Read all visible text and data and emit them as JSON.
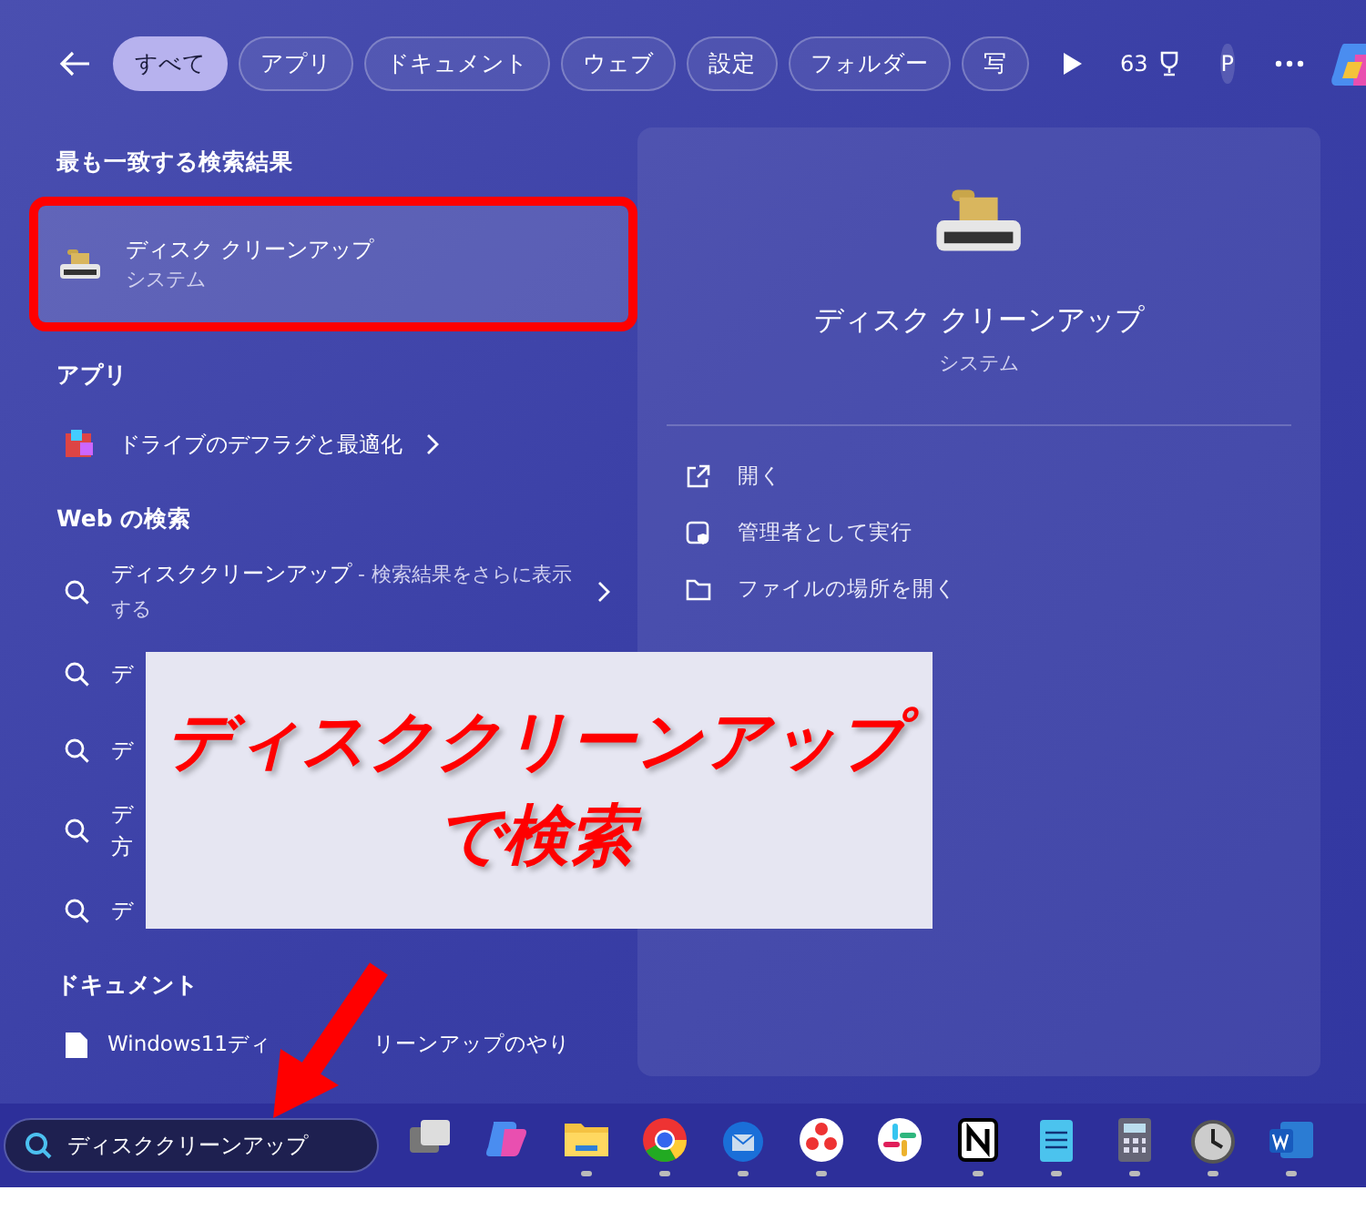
{
  "header": {
    "tabs": [
      {
        "label": "すべて",
        "selected": true
      },
      {
        "label": "アプリ",
        "selected": false
      },
      {
        "label": "ドキュメント",
        "selected": false
      },
      {
        "label": "ウェブ",
        "selected": false
      },
      {
        "label": "設定",
        "selected": false
      },
      {
        "label": "フォルダー",
        "selected": false
      },
      {
        "label": "写",
        "selected": false
      }
    ],
    "points": "63",
    "account": "P"
  },
  "best_match": {
    "heading": "最も一致する検索結果",
    "title": "ディスク クリーンアップ",
    "subtitle": "システム",
    "marked": true
  },
  "apps": {
    "heading": "アプリ",
    "items": [
      {
        "label": "ドライブのデフラグと最適化"
      }
    ]
  },
  "web": {
    "heading": "Web の検索",
    "items": [
      {
        "text": "ディスククリーンアップ",
        "suffix": "- 検索結果をさらに表示する",
        "chevron": true
      },
      {
        "text": "デ"
      },
      {
        "text": "デ"
      },
      {
        "text": "デ",
        "line2": "方"
      },
      {
        "text": "デ"
      }
    ]
  },
  "documents": {
    "heading": "ドキュメント",
    "items": [
      {
        "label": "Windows11ディ",
        "label_after_arrow": "リーンアップのやり"
      }
    ]
  },
  "preview": {
    "title": "ディスク クリーンアップ",
    "subtitle": "システム",
    "actions": [
      {
        "label": "開く",
        "kind": "open"
      },
      {
        "label": "管理者として実行",
        "kind": "admin"
      },
      {
        "label": "ファイルの場所を開く",
        "kind": "folder"
      }
    ]
  },
  "annotation": {
    "lines": [
      "ディスククリーンアップ",
      "で検索"
    ]
  },
  "taskbar": {
    "search_value": "ディスククリーンアップ",
    "apps": [
      {
        "kind": "windows",
        "running": false
      },
      {
        "kind": "copilot",
        "running": false
      },
      {
        "kind": "folder",
        "running": true
      },
      {
        "kind": "browser",
        "running": true
      },
      {
        "kind": "mail",
        "running": true
      },
      {
        "kind": "dots",
        "running": true
      },
      {
        "kind": "chat",
        "running": false
      },
      {
        "kind": "notes",
        "running": true
      },
      {
        "kind": "notepad",
        "running": true
      },
      {
        "kind": "calculator",
        "running": true
      },
      {
        "kind": "clock",
        "running": true
      },
      {
        "kind": "word",
        "running": true
      }
    ]
  }
}
